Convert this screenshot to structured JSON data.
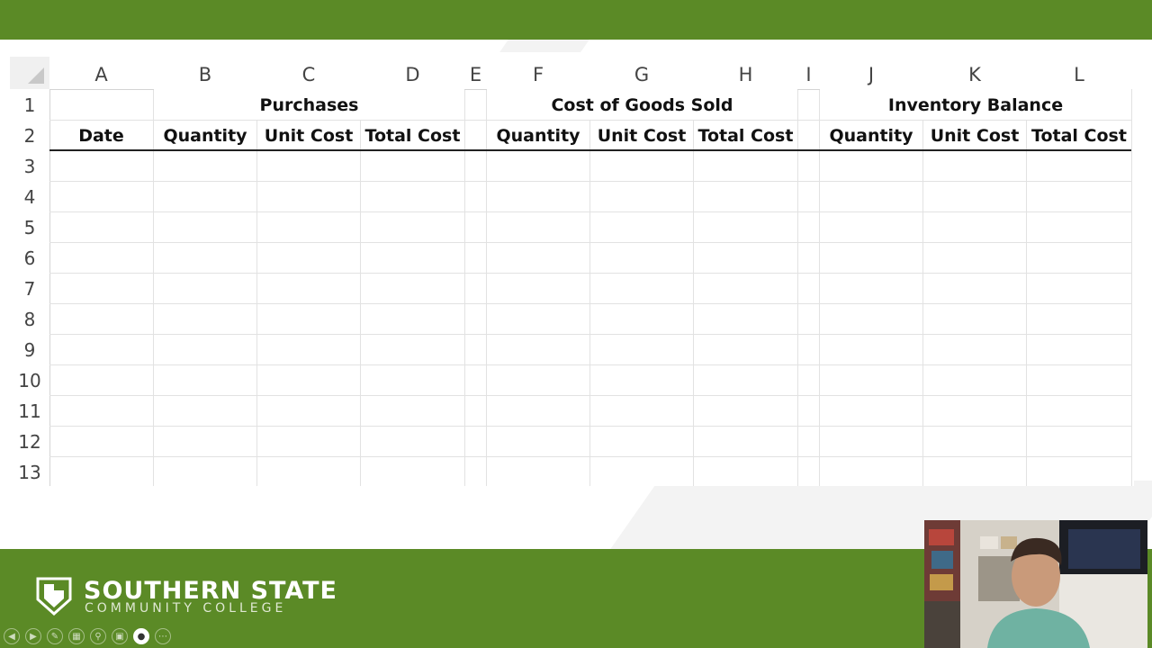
{
  "spreadsheet": {
    "columns": [
      "A",
      "B",
      "C",
      "D",
      "E",
      "F",
      "G",
      "H",
      "I",
      "J",
      "K",
      "L"
    ],
    "rows": [
      "1",
      "2",
      "3",
      "4",
      "5",
      "6",
      "7",
      "8",
      "9",
      "10",
      "11",
      "12",
      "13"
    ],
    "groups": {
      "purchases": "Purchases",
      "cogs": "Cost of Goods Sold",
      "inventory": "Inventory Balance"
    },
    "headers": {
      "date": "Date",
      "purchases": [
        "Quantity",
        "Unit Cost",
        "Total Cost"
      ],
      "cogs": [
        "Quantity",
        "Unit Cost",
        "Total Cost"
      ],
      "inventory": [
        "Quantity",
        "Unit Cost",
        "Total Cost"
      ]
    }
  },
  "branding": {
    "line1": "SOUTHERN STATE",
    "line2": "COMMUNITY COLLEGE",
    "accent": "#5b8a26"
  },
  "slideshow_controls": [
    "previous-icon",
    "next-icon",
    "pen-icon",
    "slides-icon",
    "zoom-icon",
    "subtitles-icon",
    "camera-icon",
    "more-icon"
  ]
}
